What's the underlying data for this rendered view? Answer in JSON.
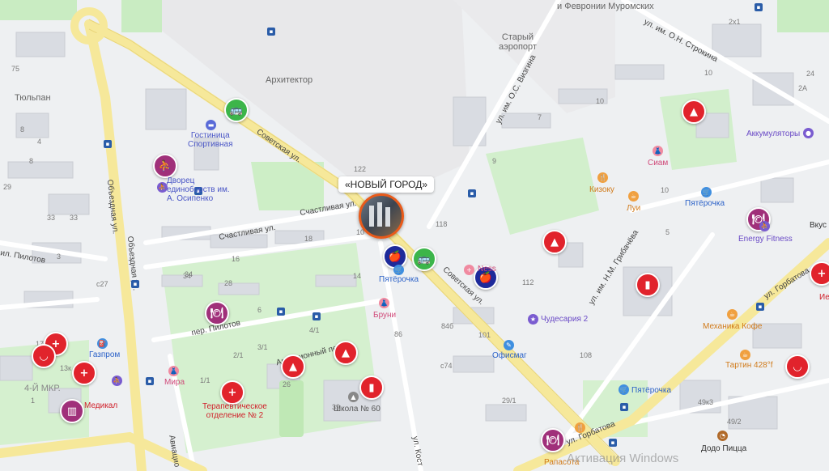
{
  "map": {
    "callout": "«НОВЫЙ ГОРОД»",
    "watermark": "Активация Windows",
    "streets": {
      "sovetskaya_1": "Советская ул.",
      "sovetskaya_2": "Советская ул.",
      "schastlivaya_1": "Счастливая ул.",
      "schastlivaya_2": "Счастливая ул.",
      "obezdnaya": "Объездная ул.",
      "pilotov": "пер. Пилотов",
      "aviatsionny": "Авиационный пер.",
      "gorbatova_1": "ул. Горбатова",
      "gorbatova_2": "ул. Горбатова",
      "vizgina": "ул. им. О.С. Визгина",
      "stroikina": "ул. им. О.Н. Строкина",
      "gribacheva": "ул. им. Н.М. Грибачёва",
      "avia_bottom": "Авиацио",
      "kostya": "ул. Кост",
      "pil_left": "ил. Пилотов"
    },
    "areas": {
      "arkhitektor": "Архитектор",
      "stary_aeroport": "Старый\nаэропорт",
      "tyulpan": "Тюльпан",
      "fevronii": "и Февронии Муромских"
    },
    "numbers": [
      "75",
      "8",
      "4",
      "8",
      "29",
      "33",
      "10",
      "7",
      "9",
      "10",
      "2x1",
      "10",
      "122",
      "118",
      "18",
      "10",
      "16",
      "34",
      "28",
      "6",
      "14",
      "112",
      "84б",
      "101",
      "86",
      "108",
      "4/1",
      "3/1",
      "2/1",
      "1/1",
      "26",
      "c27",
      "c74",
      "29/1",
      "49/2",
      "49к3",
      "17",
      "13к",
      "24",
      "2А",
      "3",
      "5",
      "1",
      "34",
      "39",
      "33"
    ],
    "pois": {
      "gostinitsa": "Гостиница\nСпортивная",
      "dvorets": "Дворец\nединоборств им.\nА. Осипенко",
      "pyaterochka_1": "Пятёрочка",
      "pyaterochka_2": "Пятёрочка",
      "pyaterochka_3": "Пятёрочка",
      "bruni": "Бруни",
      "kizoku": "Кизоку",
      "lui": "Луи",
      "siam": "Сиам",
      "akkumulyatory": "Аккумуляторы",
      "energy_fitness": "Energy Fitness",
      "vkus": "Вкус",
      "chudesariya": "Чудесария 2",
      "ofismag": "Офисмаг",
      "mekhanika": "Механика Кофе",
      "tartin": "Тартин 428°f",
      "shkola": "Школа № 60",
      "terapevt": "Терапевтическое\nотделение № 2",
      "gazprom": "Газпром",
      "mira": "Мира",
      "medikal": "Медикал",
      "dodo": "Додо Пицца",
      "rapasota": "Рапасота",
      "4mkr": "4-Й МКР.",
      "ness": "Ness",
      "ii": "Ие"
    }
  }
}
